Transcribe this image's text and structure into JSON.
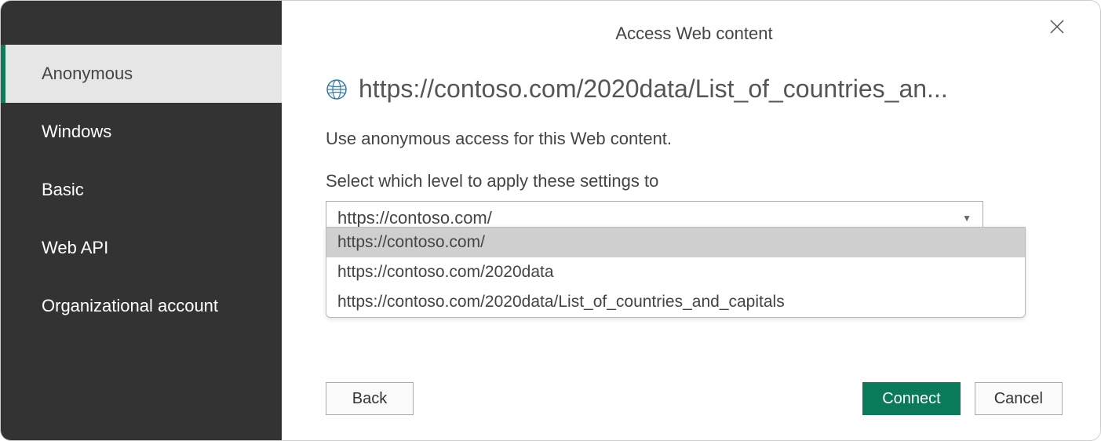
{
  "header": {
    "title": "Access Web content"
  },
  "sidebar": {
    "items": [
      {
        "label": "Anonymous",
        "selected": true
      },
      {
        "label": "Windows",
        "selected": false
      },
      {
        "label": "Basic",
        "selected": false
      },
      {
        "label": "Web API",
        "selected": false
      },
      {
        "label": "Organizational account",
        "selected": false
      }
    ]
  },
  "main": {
    "url": "https://contoso.com/2020data/List_of_countries_an...",
    "description": "Use anonymous access for this Web content.",
    "level_label": "Select which level to apply these settings to",
    "level_selected": "https://contoso.com/",
    "level_options": [
      {
        "label": "https://contoso.com/",
        "highlighted": true
      },
      {
        "label": "https://contoso.com/2020data",
        "highlighted": false
      },
      {
        "label": "https://contoso.com/2020data/List_of_countries_and_capitals",
        "highlighted": false
      }
    ]
  },
  "buttons": {
    "back": "Back",
    "connect": "Connect",
    "cancel": "Cancel"
  }
}
